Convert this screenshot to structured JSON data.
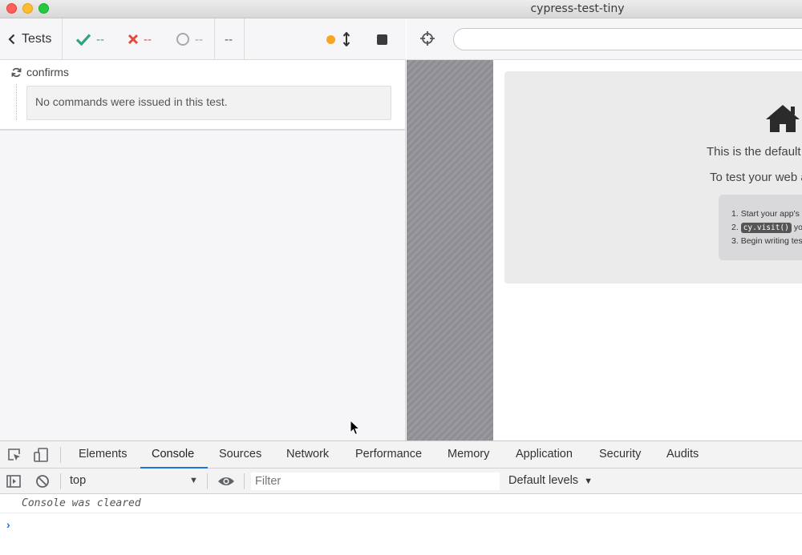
{
  "window": {
    "title": "cypress-test-tiny"
  },
  "reporter": {
    "back_label": "Tests",
    "passed": "--",
    "failed": "--",
    "pending": "--",
    "duration": "--",
    "test_title": "confirms",
    "no_commands": "No commands were issued in this test."
  },
  "aut": {
    "url": "",
    "line1": "This is the default b",
    "line2": "To test your web a",
    "steps": [
      "Start your app's",
      "you",
      "Begin writing tes"
    ],
    "code": "cy.visit()"
  },
  "devtools": {
    "tabs": [
      "Elements",
      "Console",
      "Sources",
      "Network",
      "Performance",
      "Memory",
      "Application",
      "Security",
      "Audits"
    ],
    "active_tab": "Console",
    "context": "top",
    "filter_placeholder": "Filter",
    "levels": "Default levels",
    "console_message": "Console was cleared"
  },
  "colors": {
    "passed": "#2ea57b",
    "failed": "#e04a3f",
    "running": "#f5a623",
    "accent": "#1a73e8"
  }
}
